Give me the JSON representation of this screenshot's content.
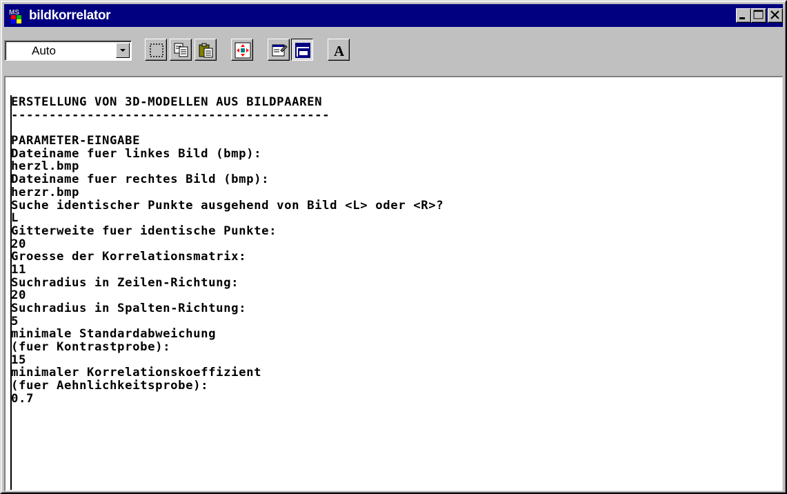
{
  "window": {
    "title": "bildkorrelator",
    "app_icon_text": "MS"
  },
  "toolbar": {
    "font_size_value": "Auto",
    "tools": [
      {
        "name": "mark-icon"
      },
      {
        "name": "copy-icon"
      },
      {
        "name": "paste-icon"
      },
      {
        "name": "fullscreen-icon"
      },
      {
        "name": "properties-icon"
      },
      {
        "name": "background-icon"
      },
      {
        "name": "font-icon",
        "glyph": "A"
      }
    ]
  },
  "console": {
    "lines": [
      "ERSTELLUNG VON 3D-MODELLEN AUS BILDPAAREN",
      "------------------------------------------",
      "",
      "PARAMETER-EINGABE",
      "Dateiname fuer linkes Bild (bmp):",
      "herzl.bmp",
      "Dateiname fuer rechtes Bild (bmp):",
      "herzr.bmp",
      "Suche identischer Punkte ausgehend von Bild <L> oder <R>?",
      "L",
      "Gitterweite fuer identische Punkte:",
      "20",
      "Groesse der Korrelationsmatrix:",
      "11",
      "Suchradius in Zeilen-Richtung:",
      "20",
      "Suchradius in Spalten-Richtung:",
      "5",
      "minimale Standardabweichung",
      "(fuer Kontrastprobe):",
      "15",
      "minimaler Korrelationskoeffizient",
      "(fuer Aehnlichkeitsprobe):",
      "0.7"
    ]
  }
}
